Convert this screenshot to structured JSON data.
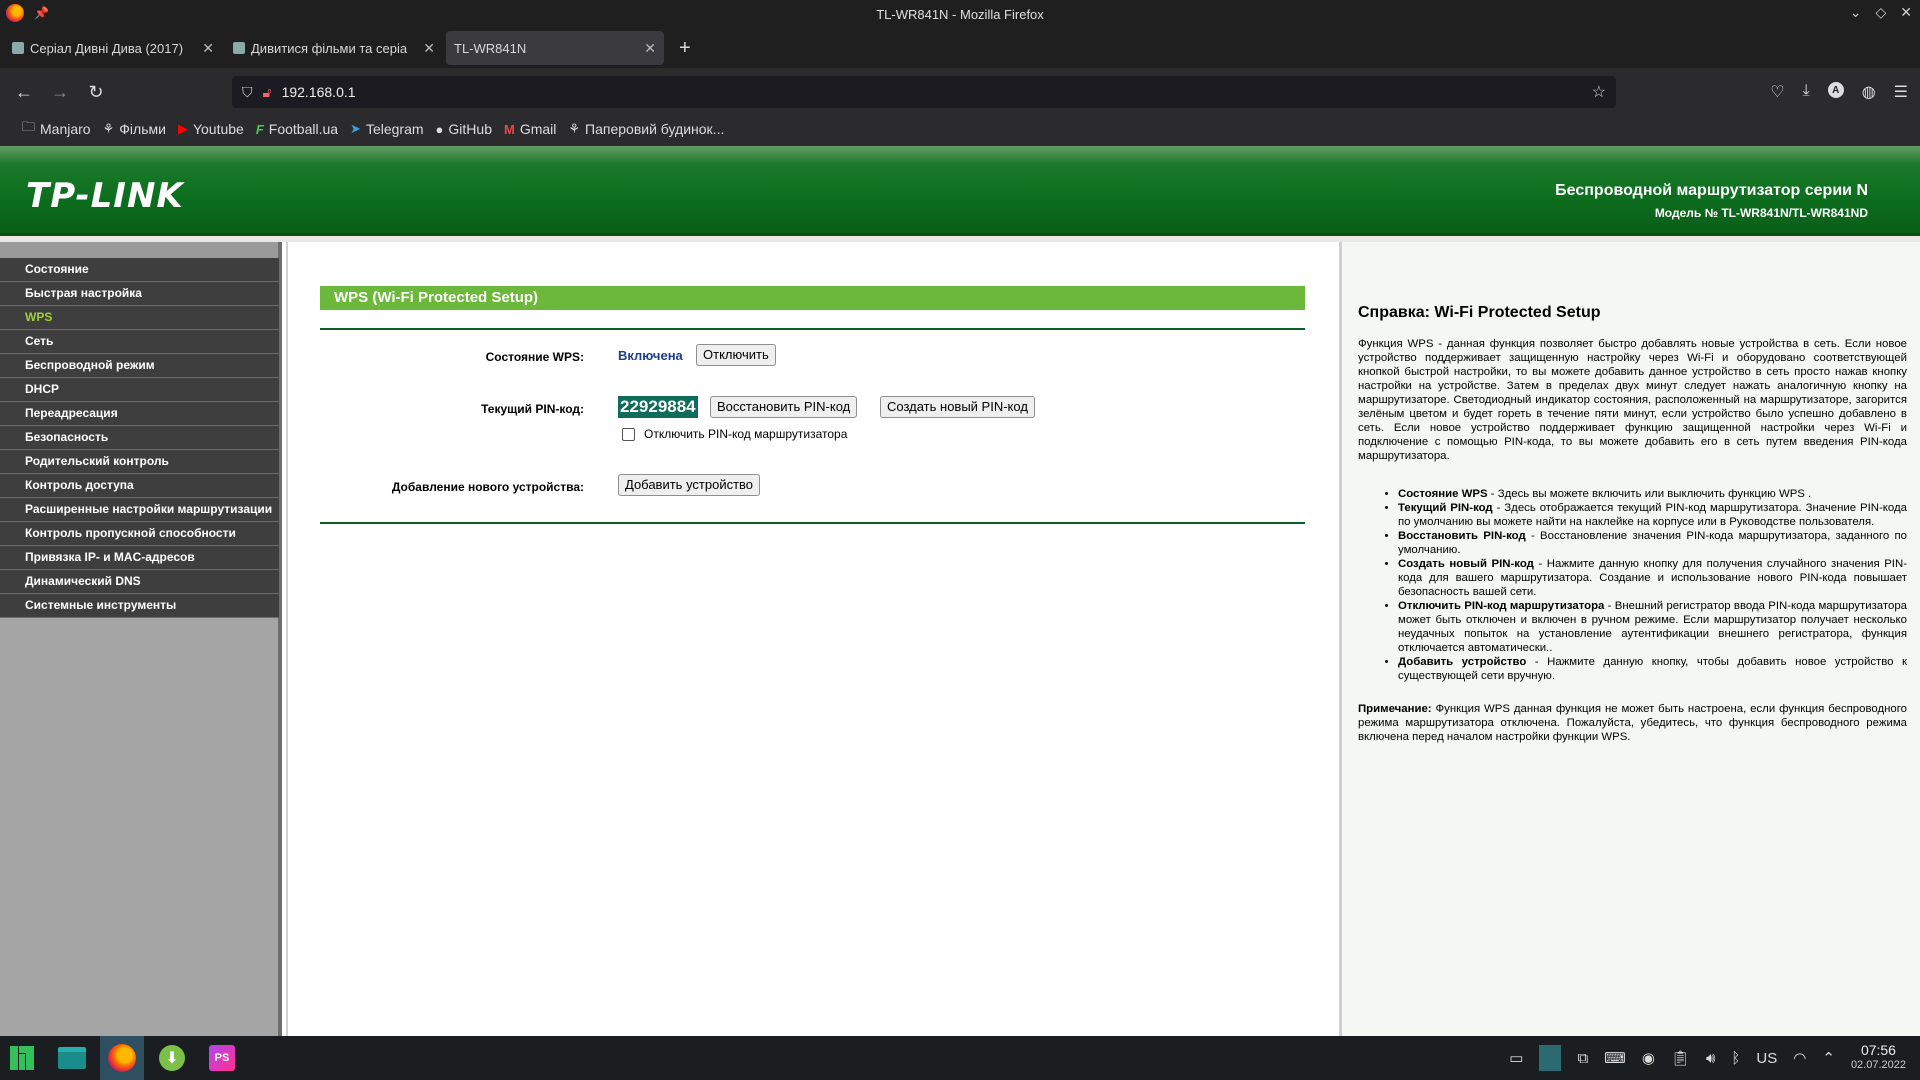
{
  "window": {
    "title": "TL-WR841N - Mozilla Firefox"
  },
  "tabs": [
    {
      "title": "Серіал Дивні Дива (2017)",
      "active": false
    },
    {
      "title": "Дивитися фільми та серіа",
      "active": false
    },
    {
      "title": "TL-WR841N",
      "active": true
    }
  ],
  "nav": {
    "url": "192.168.0.1"
  },
  "bookmarks": [
    {
      "label": "Manjaro",
      "icon": "folder-icon"
    },
    {
      "label": "Фільми",
      "icon": "film-icon"
    },
    {
      "label": "Youtube",
      "icon": "youtube-icon"
    },
    {
      "label": "Football.ua",
      "icon": "football-icon"
    },
    {
      "label": "Telegram",
      "icon": "telegram-icon"
    },
    {
      "label": "GitHub",
      "icon": "github-icon"
    },
    {
      "label": "Gmail",
      "icon": "gmail-icon"
    },
    {
      "label": "Паперовий будинок...",
      "icon": "film-icon"
    }
  ],
  "router": {
    "logo": "TP-LINK",
    "header_title": "Беспроводной маршрутизатор серии N",
    "header_model": "Модель № TL-WR841N/TL-WR841ND",
    "menu": [
      {
        "label": "Состояние",
        "active": false
      },
      {
        "label": "Быстрая настройка",
        "active": false
      },
      {
        "label": "WPS",
        "active": true
      },
      {
        "label": "Сеть",
        "active": false
      },
      {
        "label": "Беспроводной режим",
        "active": false
      },
      {
        "label": "DHCP",
        "active": false
      },
      {
        "label": "Переадресация",
        "active": false
      },
      {
        "label": "Безопасность",
        "active": false
      },
      {
        "label": "Родительский контроль",
        "active": false
      },
      {
        "label": "Контроль доступа",
        "active": false
      },
      {
        "label": "Расширенные настройки маршрутизации",
        "active": false
      },
      {
        "label": "Контроль пропускной способности",
        "active": false
      },
      {
        "label": "Привязка IP- и MAC-адресов",
        "active": false
      },
      {
        "label": "Динамический DNS",
        "active": false
      },
      {
        "label": "Системные инструменты",
        "active": false
      }
    ],
    "section_title": "WPS (Wi-Fi Protected Setup)",
    "wps_state_label": "Состояние WPS:",
    "wps_state_value": "Включена",
    "disable_button": "Отключить",
    "pin_label": "Текущий PIN-код:",
    "pin_value": "22929884",
    "restore_pin_button": "Восстановить PIN-код",
    "new_pin_button": "Создать новый PIN-код",
    "disable_pin_checkbox": "Отключить PIN-код маршрутизатора",
    "add_device_label": "Добавление нового устройства:",
    "add_device_button": "Добавить устройство"
  },
  "help": {
    "title": "Справка: Wi-Fi Protected Setup",
    "intro": "Функция WPS - данная функция позволяет быстро добавлять новые устройства в сеть. Если новое устройство поддерживает защищенную настройку через Wi-Fi и оборудовано соответствующей кнопкой быстрой настройки, то вы можете добавить данное устройство в сеть просто нажав кнопку настройки на устройстве. Затем в пределах двух минут следует нажать аналогичную кнопку на маршрутизаторе. Светодиодный индикатор состояния, расположенный на маршрутизаторе, загорится зелёным цветом и будет гореть в течение пяти минут, если устройство было успешно добавлено в сеть. Если новое устройство поддерживает функцию защищенной настройки через Wi-Fi и подключение с помощью PIN-кода, то вы можете добавить его в сеть путем введения PIN-кода маршрутизатора.",
    "items": [
      {
        "term": "Состояние WPS",
        "text": " - Здесь вы можете включить или выключить функцию WPS ."
      },
      {
        "term": "Текущий PIN-код",
        "text": " - Здесь отображается текущий PIN-код маршрутизатора. Значение PIN-кода по умолчанию вы можете найти на наклейке на корпусе или в Руководстве пользователя."
      },
      {
        "term": "Восстановить PIN-код",
        "text": " - Восстановление значения PIN-кода маршрутизатора, заданного по умолчанию."
      },
      {
        "term": "Создать новый PIN-код",
        "text": " - Нажмите данную кнопку для получения случайного значения PIN-кода для вашего маршрутизатора. Создание и использование нового PIN-кода повышает безопасность вашей сети."
      },
      {
        "term": "Отключить PIN-код маршрутизатора",
        "text": " - Внешний регистратор ввода PIN-кода маршрутизатора может быть отключен и включен в ручном режиме. Если маршрутизатор получает несколько неудачных попыток на установление аутентификации внешнего регистратора, функция отключается автоматически.."
      },
      {
        "term": "Добавить устройство",
        "text": " - Нажмите данную кнопку, чтобы добавить новое устройство к существующей сети вручную."
      }
    ],
    "note_term": "Примечание:",
    "note_text": " Функция WPS данная функция не может быть настроена, если функция беспроводного режима маршрутизатора отключена. Пожалуйста, убедитесь, что функция беспроводного режима включена перед началом настройки функции WPS."
  },
  "taskbar": {
    "keyboard_layout": "US",
    "time": "07:56",
    "date": "02.07.2022"
  },
  "colors": {
    "header_green": "#1b7a2b",
    "section_green": "#6cb83a",
    "menu_active": "#9fd13a",
    "pin_highlight": "#0f6b5a"
  }
}
